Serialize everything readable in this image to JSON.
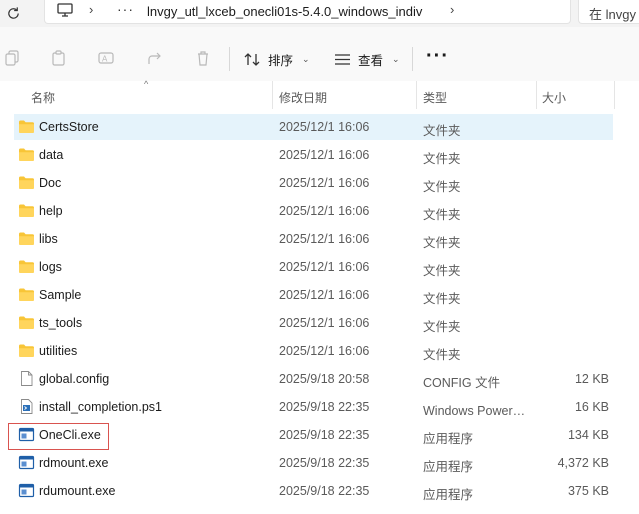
{
  "address": {
    "path": "lnvgy_utl_lxceb_onecli01s-5.4.0_windows_indiv",
    "more": "···",
    "search_partial": "在 lnvgy"
  },
  "toolbar": {
    "sort_label": "排序",
    "view_label": "查看",
    "more_label": "···"
  },
  "columns": {
    "name": "名称",
    "date": "修改日期",
    "type": "类型",
    "size": "大小"
  },
  "files": [
    {
      "name": "CertsStore",
      "date": "2025/12/1 16:06",
      "type": "文件夹",
      "size": "",
      "kind": "folder",
      "selected": true
    },
    {
      "name": "data",
      "date": "2025/12/1 16:06",
      "type": "文件夹",
      "size": "",
      "kind": "folder"
    },
    {
      "name": "Doc",
      "date": "2025/12/1 16:06",
      "type": "文件夹",
      "size": "",
      "kind": "folder"
    },
    {
      "name": "help",
      "date": "2025/12/1 16:06",
      "type": "文件夹",
      "size": "",
      "kind": "folder"
    },
    {
      "name": "libs",
      "date": "2025/12/1 16:06",
      "type": "文件夹",
      "size": "",
      "kind": "folder"
    },
    {
      "name": "logs",
      "date": "2025/12/1 16:06",
      "type": "文件夹",
      "size": "",
      "kind": "folder"
    },
    {
      "name": "Sample",
      "date": "2025/12/1 16:06",
      "type": "文件夹",
      "size": "",
      "kind": "folder"
    },
    {
      "name": "ts_tools",
      "date": "2025/12/1 16:06",
      "type": "文件夹",
      "size": "",
      "kind": "folder"
    },
    {
      "name": "utilities",
      "date": "2025/12/1 16:06",
      "type": "文件夹",
      "size": "",
      "kind": "folder"
    },
    {
      "name": "global.config",
      "date": "2025/9/18 20:58",
      "type": "CONFIG 文件",
      "size": "12 KB",
      "kind": "config"
    },
    {
      "name": "install_completion.ps1",
      "date": "2025/9/18 22:35",
      "type": "Windows PowerShell 脚本",
      "size": "16 KB",
      "kind": "script"
    },
    {
      "name": "OneCli.exe",
      "date": "2025/9/18 22:35",
      "type": "应用程序",
      "size": "134 KB",
      "kind": "exe",
      "highlighted": true
    },
    {
      "name": "rdmount.exe",
      "date": "2025/9/18 22:35",
      "type": "应用程序",
      "size": "4,372 KB",
      "kind": "exe"
    },
    {
      "name": "rdumount.exe",
      "date": "2025/9/18 22:35",
      "type": "应用程序",
      "size": "375 KB",
      "kind": "exe"
    }
  ],
  "colors": {
    "folder": "#f8c537",
    "selected_row": "#e5f3fb",
    "highlight_border": "#d9534f",
    "exe_icon": "#1f5fa8"
  }
}
